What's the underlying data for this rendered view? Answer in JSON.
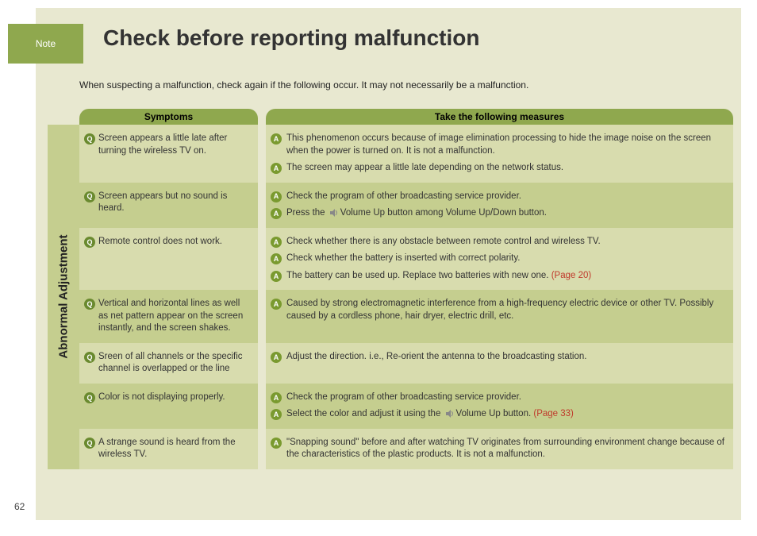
{
  "note_label": "Note",
  "page_title": "Check before reporting malfunction",
  "intro_text": "When suspecting a malfunction, check again if the following occur. It may not necessarily be a malfunction.",
  "page_number": "62",
  "col_symptoms": "Symptoms",
  "col_measures": "Take the following measures",
  "category_label": "Abnormal Adjustment",
  "rows": [
    {
      "symptom": "Screen appears a little late after turning the wireless TV on.",
      "answers": [
        {
          "text": "This phenomenon occurs because of image elimination processing to hide the image noise on the screen when the power is turned on. It is not a malfunction."
        },
        {
          "text": "The screen may appear a little late depending on the network status."
        }
      ]
    },
    {
      "symptom": "Screen appears but no sound is heard.",
      "answers": [
        {
          "text": "Check the program of other broadcasting service provider."
        },
        {
          "prefix": "Press the ",
          "icon": true,
          "suffix": "Volume Up button among Volume Up/Down button."
        }
      ]
    },
    {
      "symptom": "Remote control does not work.",
      "answers": [
        {
          "text": "Check whether there is any obstacle between remote control and wireless TV."
        },
        {
          "text": "Check whether the battery is inserted with correct polarity."
        },
        {
          "text": "The battery can be used up. Replace two batteries with new one. ",
          "page_ref": "(Page 20)"
        }
      ]
    },
    {
      "symptom": "Vertical and horizontal lines as well as net pattern appear on the screen instantly, and the screen shakes.",
      "answers": [
        {
          "text": "Caused by strong electromagnetic interference from a high-frequency electric device or other TV.  Possibly caused by a cordless phone, hair dryer, electric drill, etc."
        }
      ]
    },
    {
      "symptom": "Sreen of all channels or the specific channel is overlapped or the line",
      "answers": [
        {
          "text": "Adjust the direction. i.e., Re-orient the antenna to the broadcasting station."
        }
      ]
    },
    {
      "symptom": "Color is not displaying properly.",
      "answers": [
        {
          "text": "Check the program of other broadcasting service provider."
        },
        {
          "prefix": "Select the color and adjust it using the  ",
          "icon": true,
          "suffix": "Volume Up button. ",
          "page_ref": "(Page 33)"
        }
      ]
    },
    {
      "symptom": "A strange sound is heard from the wireless TV.",
      "answers": [
        {
          "text": "\"Snapping sound\" before and after watching TV originates from surrounding environment change because of the characteristics of the plastic products. It is not a malfunction."
        }
      ]
    }
  ]
}
